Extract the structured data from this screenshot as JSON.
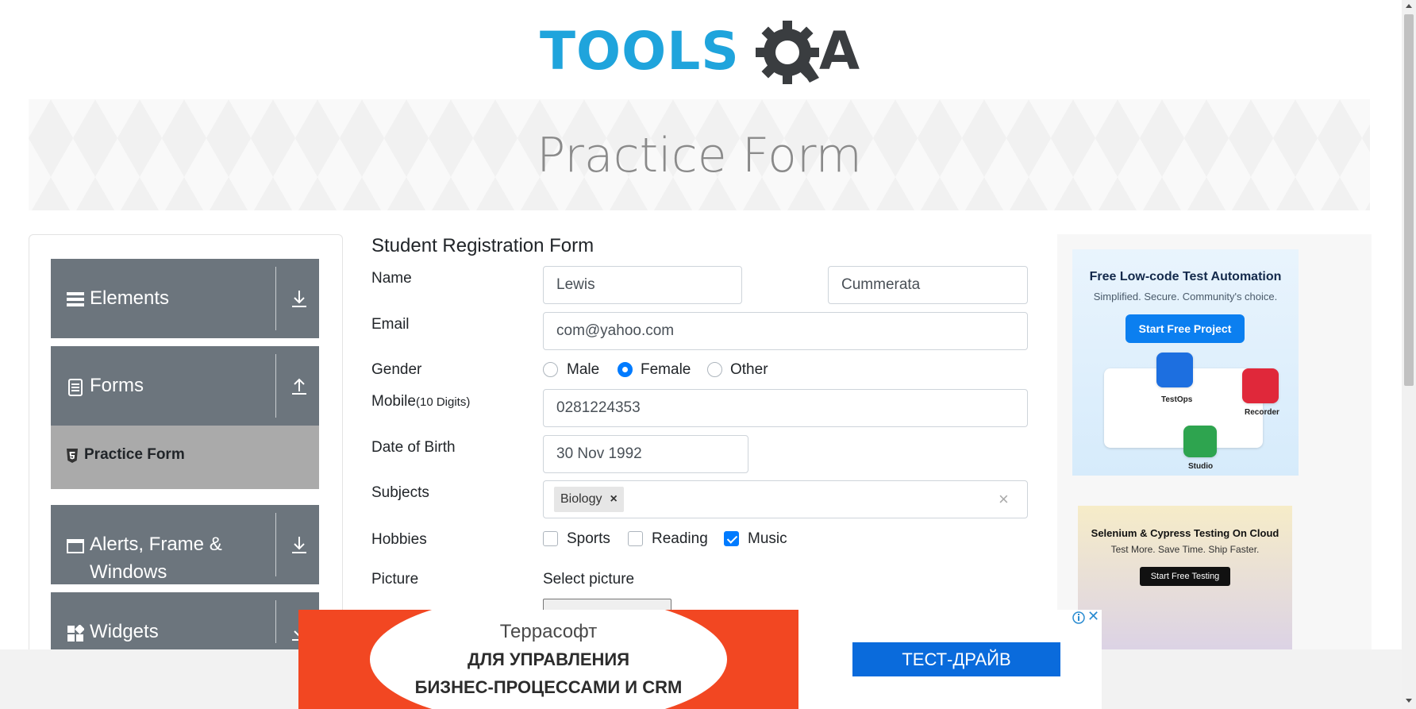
{
  "header": {
    "logo_text_left": "TOOLS",
    "logo_text_right": "A"
  },
  "banner": {
    "title": "Practice Form"
  },
  "menu": {
    "groups": [
      {
        "label": "Elements",
        "icon": "hamburger-icon",
        "arrow": "download-arrow-icon"
      },
      {
        "label": "Forms",
        "icon": "document-icon",
        "arrow": "upload-arrow-icon"
      },
      {
        "label": "Alerts, Frame &",
        "label2": "Windows",
        "icon": "window-icon",
        "arrow": "download-arrow-icon"
      },
      {
        "label": "Widgets",
        "icon": "widgets-icon",
        "arrow": "download-arrow-icon"
      }
    ],
    "active_item": {
      "label": "Practice Form",
      "icon": "html5-icon"
    }
  },
  "form": {
    "title": "Student Registration Form",
    "name_label": "Name",
    "first_name": "Lewis",
    "last_name": "Cummerata",
    "email_label": "Email",
    "email": "com@yahoo.com",
    "gender_label": "Gender",
    "gender_options": [
      "Male",
      "Female",
      "Other"
    ],
    "gender_selected": "Female",
    "mobile_label": "Mobile",
    "mobile_hint": "(10 Digits)",
    "mobile": "0281224353",
    "dob_label": "Date of Birth",
    "dob": "30 Nov 1992",
    "subjects_label": "Subjects",
    "subject_tag": "Biology",
    "subject_remove": "×",
    "subject_clear": "×",
    "hobbies_label": "Hobbies",
    "hobbies": [
      {
        "label": "Sports",
        "checked": false
      },
      {
        "label": "Reading",
        "checked": false
      },
      {
        "label": "Music",
        "checked": true
      }
    ],
    "picture_label": "Picture",
    "picture_select": "Select picture"
  },
  "ads": {
    "right_top": {
      "title": "Free Low-code Test Automation",
      "subtitle": "Simplified. Secure. Community's choice.",
      "button": "Start Free Project",
      "labels": [
        "TestOps",
        "Recorder",
        "Studio"
      ]
    },
    "right_bottom": {
      "title": "Selenium & Cypress Testing On Cloud",
      "subtitle": "Test More. Save Time. Ship Faster.",
      "button": "Start Free Testing"
    },
    "bottom": {
      "brand": "Террасофт",
      "line1": "ДЛЯ УПРАВЛЕНИЯ",
      "line2": "БИЗНЕС-ПРОЦЕССАМИ И CRM",
      "cta": "ТЕСТ-ДРАЙВ",
      "close": "✕"
    }
  },
  "colors": {
    "menu_bg": "#6c757d",
    "active_item_bg": "#aaaaaa",
    "accent": "#007bff",
    "logo_blue": "#1fa4dc",
    "ad_red": "#f24722",
    "ad_blue": "#0a6bdc"
  }
}
